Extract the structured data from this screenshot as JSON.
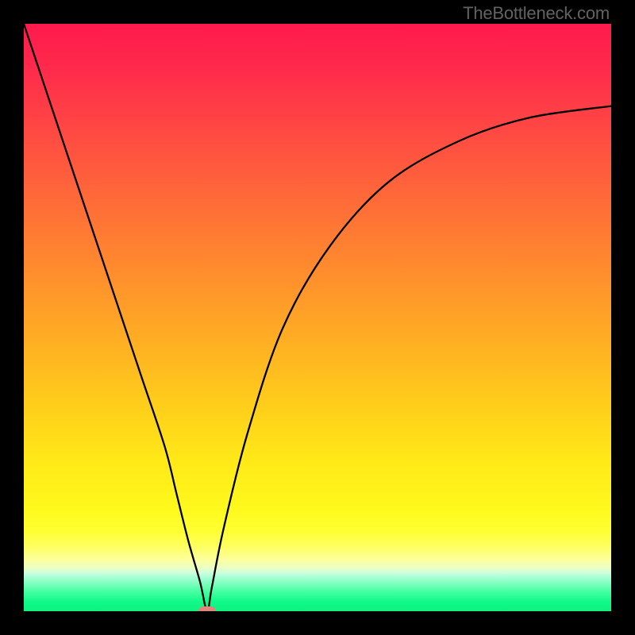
{
  "attribution": "TheBottleneck.com",
  "chart_data": {
    "type": "line",
    "title": "",
    "xlabel": "",
    "ylabel": "",
    "xlim": [
      0,
      100
    ],
    "ylim": [
      0,
      100
    ],
    "grid": false,
    "series": [
      {
        "name": "bottleneck-curve",
        "x": [
          0,
          4,
          8,
          12,
          16,
          20,
          24,
          26,
          28,
          30,
          31.2,
          32,
          34,
          38,
          44,
          52,
          62,
          74,
          86,
          100
        ],
        "values": [
          100,
          88,
          76,
          64,
          52,
          40,
          28,
          20,
          12,
          5,
          0,
          4,
          14,
          30,
          48,
          62,
          73,
          80,
          84,
          86
        ]
      }
    ],
    "markers": [
      {
        "name": "trough-marker",
        "x": 31.2,
        "y": 0,
        "shape": "rounded-rect",
        "color": "#e3837e"
      }
    ],
    "background_gradient": {
      "top_color": "#ff1a4d",
      "mid_color": "#ffd21a",
      "bottom_color": "#0ef280"
    }
  }
}
